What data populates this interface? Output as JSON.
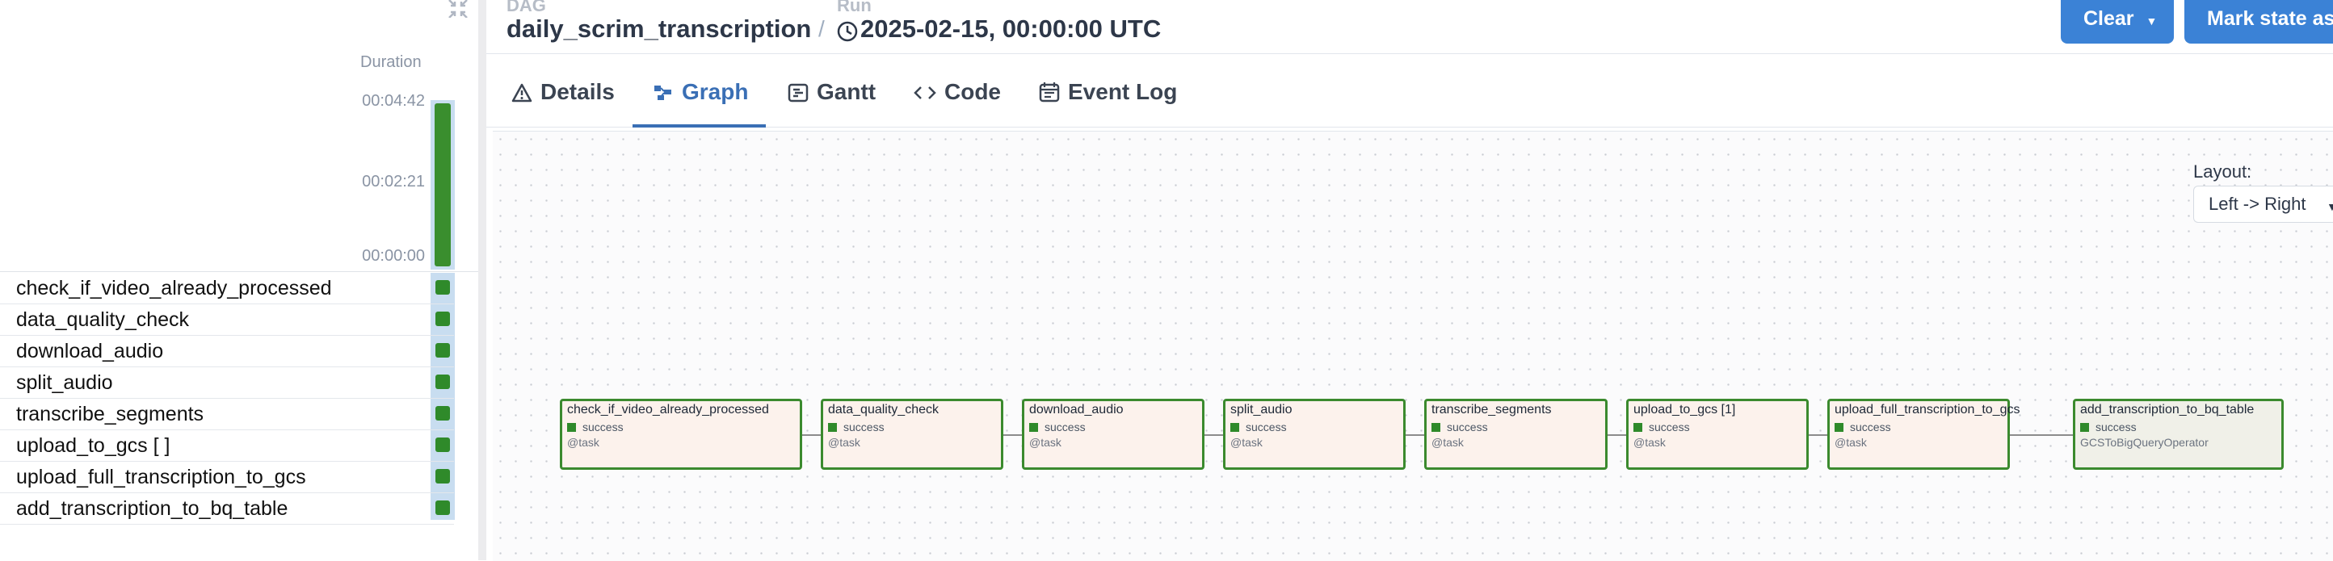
{
  "header": {
    "dag_label": "DAG",
    "dag_name": "daily_scrim_transcription",
    "separator": "/",
    "run_label": "Run",
    "run_time": "2025-02-15, 00:00:00 UTC",
    "buttons": {
      "clear": "Clear",
      "mark_state": "Mark state as..."
    }
  },
  "tabs": [
    {
      "label": "Details",
      "icon": "warning-triangle-icon"
    },
    {
      "label": "Graph",
      "icon": "graph-icon",
      "active": true
    },
    {
      "label": "Gantt",
      "icon": "gantt-icon"
    },
    {
      "label": "Code",
      "icon": "code-icon"
    },
    {
      "label": "Event Log",
      "icon": "calendar-icon"
    }
  ],
  "duration": {
    "title": "Duration",
    "ticks": [
      "00:04:42",
      "00:02:21",
      "00:00:00"
    ]
  },
  "tasks": [
    {
      "name": "check_if_video_already_processed",
      "status": "success"
    },
    {
      "name": "data_quality_check",
      "status": "success"
    },
    {
      "name": "download_audio",
      "status": "success"
    },
    {
      "name": "split_audio",
      "status": "success"
    },
    {
      "name": "transcribe_segments",
      "status": "success"
    },
    {
      "name": "upload_to_gcs [ ]",
      "status": "success"
    },
    {
      "name": "upload_full_transcription_to_gcs",
      "status": "success"
    },
    {
      "name": "add_transcription_to_bq_table",
      "status": "success"
    }
  ],
  "layout": {
    "label": "Layout:",
    "value": "Left -> Right"
  },
  "graph_nodes": [
    {
      "title": "check_if_video_already_processed",
      "state": "success",
      "kind": "@task"
    },
    {
      "title": "data_quality_check",
      "state": "success",
      "kind": "@task"
    },
    {
      "title": "download_audio",
      "state": "success",
      "kind": "@task"
    },
    {
      "title": "split_audio",
      "state": "success",
      "kind": "@task"
    },
    {
      "title": "transcribe_segments",
      "state": "success",
      "kind": "@task"
    },
    {
      "title": "upload_to_gcs [1]",
      "state": "success",
      "kind": "@task"
    },
    {
      "title": "upload_full_transcription_to_gcs",
      "state": "success",
      "kind": "@task"
    },
    {
      "title": "add_transcription_to_bq_table",
      "state": "success",
      "kind": "GCSToBigQueryOperator"
    }
  ],
  "colors": {
    "success": "#2f8a2a",
    "accent": "#3a6fb5",
    "button": "#3b82d6"
  }
}
